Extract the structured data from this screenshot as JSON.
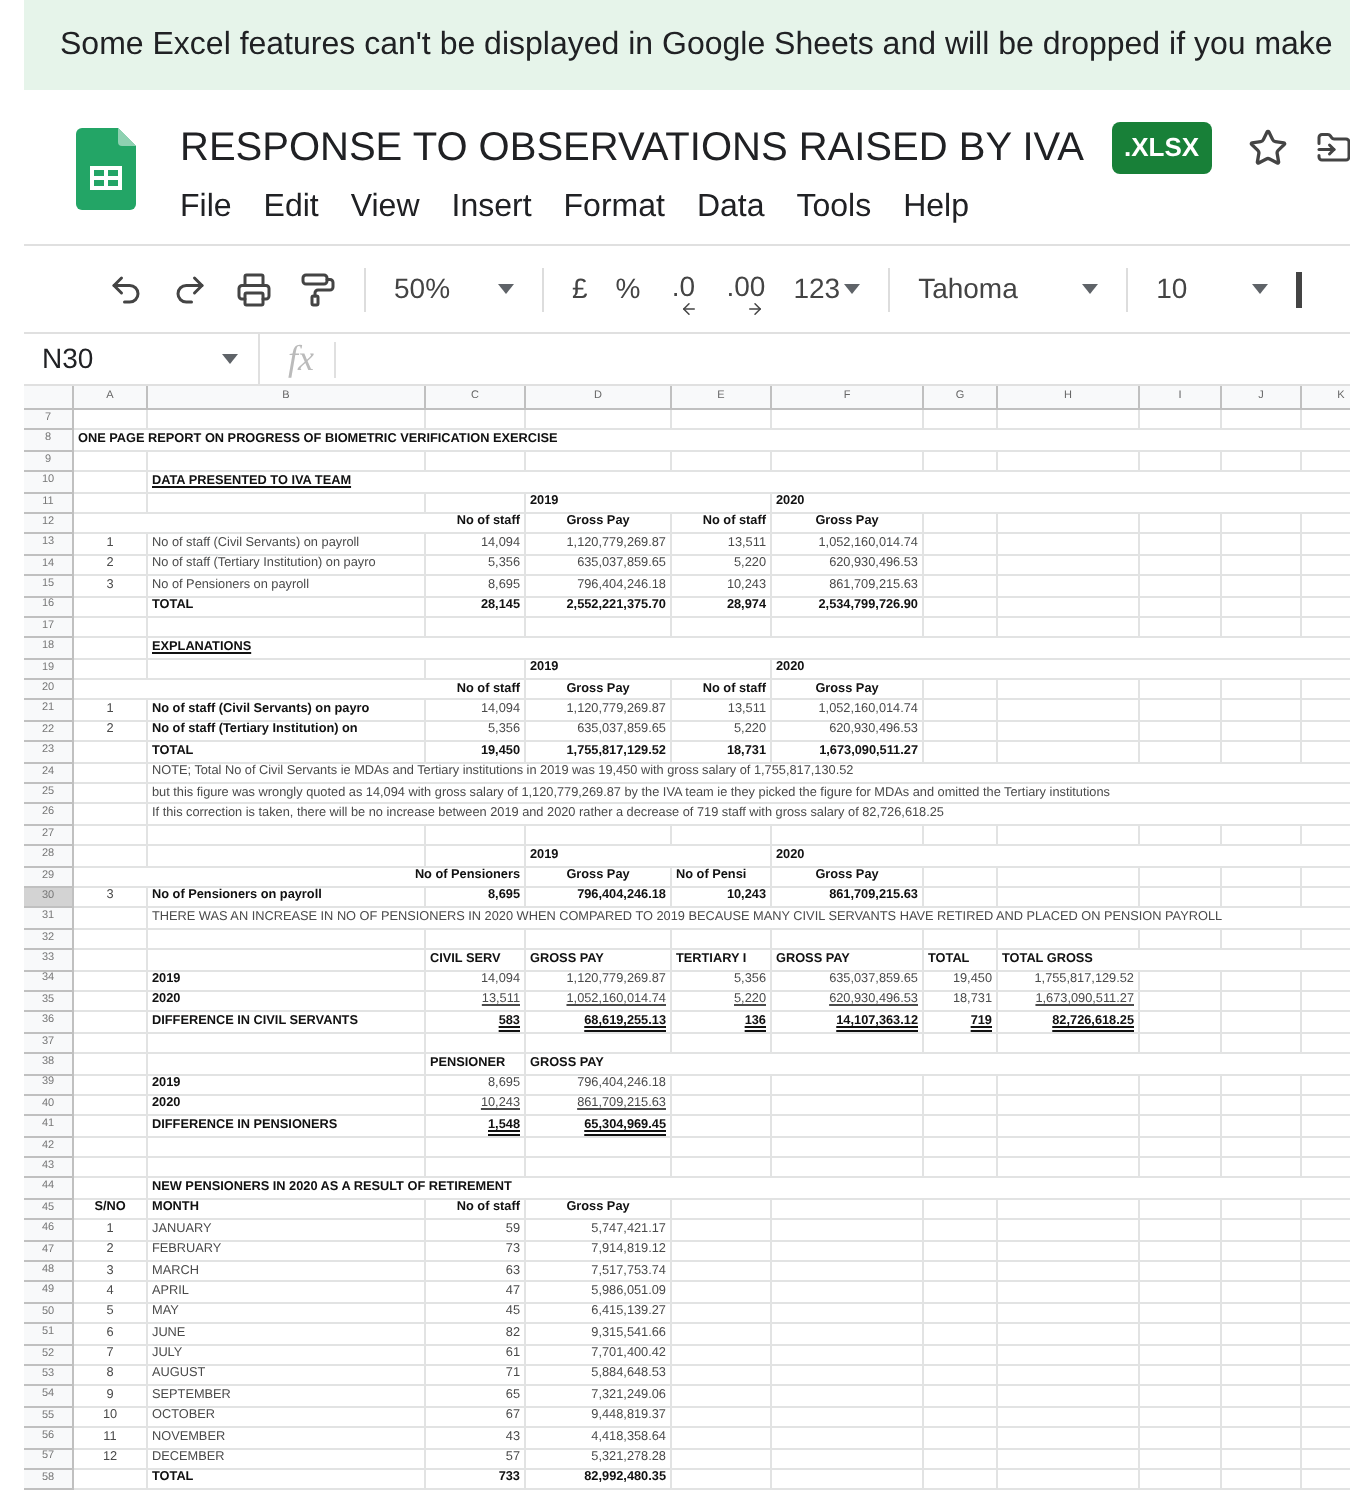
{
  "banner": {
    "text": "Some Excel features can't be displayed in Google Sheets and will be dropped if you make"
  },
  "document": {
    "title": "RESPONSE TO OBSERVATIONS RAISED BY IVA",
    "badge": ".XLSX",
    "starred": false
  },
  "menu": [
    "File",
    "Edit",
    "View",
    "Insert",
    "Format",
    "Data",
    "Tools",
    "Help"
  ],
  "toolbar": {
    "zoom": "50%",
    "currency": "£",
    "percent": "%",
    "decrease_decimals": ".0",
    "increase_decimals": ".00",
    "more_formats": "123",
    "font": "Tahoma",
    "font_size": "10"
  },
  "formula_bar": {
    "cell": "N30",
    "fx": "fx"
  },
  "columns": [
    "A",
    "B",
    "C",
    "D",
    "E",
    "F",
    "G",
    "H",
    "I",
    "J",
    "K"
  ],
  "rows": [
    {
      "number": "7",
      "selected": false
    },
    {
      "number": "8",
      "selected": false,
      "A": {
        "kind": "text",
        "bold": true,
        "text": "ONE PAGE REPORT ON PROGRESS OF BIOMETRIC VERIFICATION EXERCISE"
      }
    },
    {
      "number": "9",
      "selected": false
    },
    {
      "number": "10",
      "selected": false,
      "B": {
        "kind": "text",
        "bold": true,
        "underlined": true,
        "text": "DATA PRESENTED TO IVA TEAM"
      }
    },
    {
      "number": "11",
      "selected": false,
      "D": {
        "kind": "text",
        "bold": true,
        "text": "2019"
      },
      "F": {
        "kind": "text",
        "bold": true,
        "text": "2020"
      }
    },
    {
      "number": "12",
      "selected": false,
      "C": {
        "kind": "number",
        "bold": true,
        "text": "No of staff"
      },
      "D": {
        "kind": "center",
        "bold": true,
        "text": "Gross Pay"
      },
      "E": {
        "kind": "number",
        "bold": true,
        "text": "No of staff"
      },
      "F": {
        "kind": "center",
        "bold": true,
        "text": "Gross Pay"
      }
    },
    {
      "number": "13",
      "selected": false,
      "A": {
        "kind": "center",
        "text": "1"
      },
      "B": {
        "kind": "text",
        "text": "No of staff (Civil Servants) on payroll"
      },
      "C": {
        "kind": "number",
        "text": "14,094"
      },
      "D": {
        "kind": "number",
        "text": "1,120,779,269.87"
      },
      "E": {
        "kind": "number",
        "text": "13,511"
      },
      "F": {
        "kind": "number",
        "text": "1,052,160,014.74"
      }
    },
    {
      "number": "14",
      "selected": false,
      "A": {
        "kind": "center",
        "text": "2"
      },
      "B": {
        "kind": "text",
        "text": "No of staff (Tertiary Institution) on payro"
      },
      "C": {
        "kind": "number",
        "text": "5,356"
      },
      "D": {
        "kind": "number",
        "text": "635,037,859.65"
      },
      "E": {
        "kind": "number",
        "text": "5,220"
      },
      "F": {
        "kind": "number",
        "text": "620,930,496.53"
      }
    },
    {
      "number": "15",
      "selected": false,
      "A": {
        "kind": "center",
        "text": "3"
      },
      "B": {
        "kind": "text",
        "text": "No of Pensioners on payroll"
      },
      "C": {
        "kind": "number",
        "text": "8,695"
      },
      "D": {
        "kind": "number",
        "text": "796,404,246.18"
      },
      "E": {
        "kind": "number",
        "text": "10,243"
      },
      "F": {
        "kind": "number",
        "text": "861,709,215.63"
      }
    },
    {
      "number": "16",
      "selected": false,
      "B": {
        "kind": "text",
        "bold": true,
        "text": "TOTAL"
      },
      "C": {
        "kind": "number",
        "bold": true,
        "text": "28,145"
      },
      "D": {
        "kind": "number",
        "bold": true,
        "text": "2,552,221,375.70"
      },
      "E": {
        "kind": "number",
        "bold": true,
        "text": "28,974"
      },
      "F": {
        "kind": "number",
        "bold": true,
        "text": "2,534,799,726.90"
      }
    },
    {
      "number": "17",
      "selected": false
    },
    {
      "number": "18",
      "selected": false,
      "B": {
        "kind": "text",
        "bold": true,
        "underlined": true,
        "text": "EXPLANATIONS"
      }
    },
    {
      "number": "19",
      "selected": false,
      "D": {
        "kind": "text",
        "bold": true,
        "text": "2019"
      },
      "F": {
        "kind": "text",
        "bold": true,
        "text": "2020"
      }
    },
    {
      "number": "20",
      "selected": false,
      "C": {
        "kind": "number",
        "bold": true,
        "text": "No of staff"
      },
      "D": {
        "kind": "center",
        "bold": true,
        "text": "Gross Pay"
      },
      "E": {
        "kind": "number",
        "bold": true,
        "text": "No of staff"
      },
      "F": {
        "kind": "center",
        "bold": true,
        "text": "Gross Pay"
      }
    },
    {
      "number": "21",
      "selected": false,
      "A": {
        "kind": "center",
        "text": "1"
      },
      "B": {
        "kind": "text",
        "bold": true,
        "text": "No of staff (Civil Servants) on payro"
      },
      "C": {
        "kind": "number",
        "text": "14,094"
      },
      "D": {
        "kind": "number",
        "text": "1,120,779,269.87"
      },
      "E": {
        "kind": "number",
        "text": "13,511"
      },
      "F": {
        "kind": "number",
        "text": "1,052,160,014.74"
      }
    },
    {
      "number": "22",
      "selected": false,
      "A": {
        "kind": "center",
        "text": "2"
      },
      "B": {
        "kind": "text",
        "bold": true,
        "text": "No of staff (Tertiary Institution) on"
      },
      "C": {
        "kind": "number",
        "text": "5,356"
      },
      "D": {
        "kind": "number",
        "text": "635,037,859.65"
      },
      "E": {
        "kind": "number",
        "text": "5,220"
      },
      "F": {
        "kind": "number",
        "text": "620,930,496.53"
      }
    },
    {
      "number": "23",
      "selected": false,
      "B": {
        "kind": "text",
        "bold": true,
        "text": "TOTAL"
      },
      "C": {
        "kind": "number",
        "bold": true,
        "text": "19,450"
      },
      "D": {
        "kind": "number",
        "bold": true,
        "text": "1,755,817,129.52"
      },
      "E": {
        "kind": "number",
        "bold": true,
        "text": "18,731"
      },
      "F": {
        "kind": "number",
        "bold": true,
        "text": "1,673,090,511.27"
      }
    },
    {
      "number": "24",
      "selected": false,
      "B": {
        "kind": "text",
        "text": "NOTE; Total No of Civil Servants ie MDAs and Tertiary institutions in 2019 was 19,450 with gross salary of 1,755,817,130.52"
      }
    },
    {
      "number": "25",
      "selected": false,
      "B": {
        "kind": "text",
        "text": "but this figure was wrongly quoted as 14,094 with gross salary of 1,120,779,269.87 by the IVA team ie they picked the figure for MDAs and omitted the Tertiary institutions"
      }
    },
    {
      "number": "26",
      "selected": false,
      "B": {
        "kind": "text",
        "text": "If this correction is taken, there will be no increase between 2019 and 2020 rather a decrease of 719 staff with gross salary of 82,726,618.25"
      }
    },
    {
      "number": "27",
      "selected": false
    },
    {
      "number": "28",
      "selected": false,
      "D": {
        "kind": "text",
        "bold": true,
        "text": "2019"
      },
      "F": {
        "kind": "text",
        "bold": true,
        "text": "2020"
      }
    },
    {
      "number": "29",
      "selected": false,
      "C": {
        "kind": "number",
        "bold": true,
        "text": "No of Pensioners"
      },
      "D": {
        "kind": "center",
        "bold": true,
        "text": "Gross Pay"
      },
      "E": {
        "kind": "text",
        "bold": true,
        "text": "No of Pensi"
      },
      "F": {
        "kind": "center",
        "bold": true,
        "text": "Gross Pay"
      }
    },
    {
      "number": "30",
      "selected": true,
      "A": {
        "kind": "center",
        "text": "3"
      },
      "B": {
        "kind": "text",
        "bold": true,
        "text": "No of Pensioners on payroll"
      },
      "C": {
        "kind": "number",
        "bold": true,
        "text": "8,695"
      },
      "D": {
        "kind": "number",
        "bold": true,
        "text": "796,404,246.18"
      },
      "E": {
        "kind": "number",
        "bold": true,
        "text": "10,243"
      },
      "F": {
        "kind": "number",
        "bold": true,
        "text": "861,709,215.63"
      }
    },
    {
      "number": "31",
      "selected": false,
      "B": {
        "kind": "text",
        "text": "THERE WAS AN INCREASE IN NO OF PENSIONERS IN 2020 WHEN COMPARED TO 2019 BECAUSE MANY CIVIL SERVANTS HAVE RETIRED AND PLACED ON PENSION PAYROLL"
      }
    },
    {
      "number": "32",
      "selected": false
    },
    {
      "number": "33",
      "selected": false,
      "C": {
        "kind": "text",
        "bold": true,
        "text": "CIVIL SERV"
      },
      "D": {
        "kind": "text",
        "bold": true,
        "text": "GROSS PAY"
      },
      "E": {
        "kind": "text",
        "bold": true,
        "text": "TERTIARY I"
      },
      "F": {
        "kind": "text",
        "bold": true,
        "text": "GROSS PAY"
      },
      "G": {
        "kind": "text",
        "bold": true,
        "text": "TOTAL"
      },
      "H": {
        "kind": "text",
        "bold": true,
        "text": "TOTAL GROSS"
      }
    },
    {
      "number": "34",
      "selected": false,
      "B": {
        "kind": "text",
        "bold": true,
        "text": "2019"
      },
      "C": {
        "kind": "number",
        "text": "14,094"
      },
      "D": {
        "kind": "number",
        "text": "1,120,779,269.87"
      },
      "E": {
        "kind": "number",
        "text": "5,356"
      },
      "F": {
        "kind": "number",
        "text": "635,037,859.65"
      },
      "G": {
        "kind": "number",
        "text": "19,450"
      },
      "H": {
        "kind": "number",
        "text": "1,755,817,129.52"
      }
    },
    {
      "number": "35",
      "selected": false,
      "B": {
        "kind": "text",
        "bold": true,
        "text": "2020"
      },
      "C": {
        "kind": "number",
        "underlined": true,
        "text": "13,511"
      },
      "D": {
        "kind": "number",
        "underlined": true,
        "text": "1,052,160,014.74"
      },
      "E": {
        "kind": "number",
        "underlined": true,
        "text": "5,220"
      },
      "F": {
        "kind": "number",
        "underlined": true,
        "text": "620,930,496.53"
      },
      "G": {
        "kind": "number",
        "text": "18,731"
      },
      "H": {
        "kind": "number",
        "underlined": true,
        "text": "1,673,090,511.27"
      }
    },
    {
      "number": "36",
      "selected": false,
      "B": {
        "kind": "text",
        "bold": true,
        "text": "DIFFERENCE IN CIVIL SERVANTS"
      },
      "C": {
        "kind": "number",
        "bold": true,
        "double_underlined": true,
        "text": "583"
      },
      "D": {
        "kind": "number",
        "bold": true,
        "double_underlined": true,
        "text": "68,619,255.13"
      },
      "E": {
        "kind": "number",
        "bold": true,
        "double_underlined": true,
        "text": "136"
      },
      "F": {
        "kind": "number",
        "bold": true,
        "double_underlined": true,
        "text": "14,107,363.12"
      },
      "G": {
        "kind": "number",
        "bold": true,
        "double_underlined": true,
        "text": "719"
      },
      "H": {
        "kind": "number",
        "bold": true,
        "double_underlined": true,
        "text": "82,726,618.25"
      }
    },
    {
      "number": "37",
      "selected": false
    },
    {
      "number": "38",
      "selected": false,
      "C": {
        "kind": "text",
        "bold": true,
        "text": "PENSIONER"
      },
      "D": {
        "kind": "text",
        "bold": true,
        "text": "GROSS PAY"
      }
    },
    {
      "number": "39",
      "selected": false,
      "B": {
        "kind": "text",
        "bold": true,
        "text": "2019"
      },
      "C": {
        "kind": "number",
        "text": "8,695"
      },
      "D": {
        "kind": "number",
        "text": "796,404,246.18"
      }
    },
    {
      "number": "40",
      "selected": false,
      "B": {
        "kind": "text",
        "bold": true,
        "text": "2020"
      },
      "C": {
        "kind": "number",
        "underlined": true,
        "text": "10,243"
      },
      "D": {
        "kind": "number",
        "underlined": true,
        "text": "861,709,215.63"
      }
    },
    {
      "number": "41",
      "selected": false,
      "B": {
        "kind": "text",
        "bold": true,
        "text": "DIFFERENCE IN PENSIONERS"
      },
      "C": {
        "kind": "number",
        "bold": true,
        "double_underlined": true,
        "text": "1,548"
      },
      "D": {
        "kind": "number",
        "bold": true,
        "double_underlined": true,
        "text": "65,304,969.45"
      }
    },
    {
      "number": "42",
      "selected": false
    },
    {
      "number": "43",
      "selected": false
    },
    {
      "number": "44",
      "selected": false,
      "B": {
        "kind": "text",
        "bold": true,
        "text": "NEW PENSIONERS IN 2020 AS A RESULT OF RETIREMENT"
      }
    },
    {
      "number": "45",
      "selected": false,
      "A": {
        "kind": "center",
        "bold": true,
        "text": "S/NO"
      },
      "B": {
        "kind": "text",
        "bold": true,
        "text": "MONTH"
      },
      "C": {
        "kind": "number",
        "bold": true,
        "text": "No of staff"
      },
      "D": {
        "kind": "center",
        "bold": true,
        "text": "Gross Pay"
      }
    },
    {
      "number": "46",
      "selected": false,
      "A": {
        "kind": "center",
        "text": "1"
      },
      "B": {
        "kind": "text",
        "text": "JANUARY"
      },
      "C": {
        "kind": "number",
        "text": "59"
      },
      "D": {
        "kind": "number",
        "text": "5,747,421.17"
      }
    },
    {
      "number": "47",
      "selected": false,
      "A": {
        "kind": "center",
        "text": "2"
      },
      "B": {
        "kind": "text",
        "text": "FEBRUARY"
      },
      "C": {
        "kind": "number",
        "text": "73"
      },
      "D": {
        "kind": "number",
        "text": "7,914,819.12"
      }
    },
    {
      "number": "48",
      "selected": false,
      "A": {
        "kind": "center",
        "text": "3"
      },
      "B": {
        "kind": "text",
        "text": "MARCH"
      },
      "C": {
        "kind": "number",
        "text": "63"
      },
      "D": {
        "kind": "number",
        "text": "7,517,753.74"
      }
    },
    {
      "number": "49",
      "selected": false,
      "A": {
        "kind": "center",
        "text": "4"
      },
      "B": {
        "kind": "text",
        "text": "APRIL"
      },
      "C": {
        "kind": "number",
        "text": "47"
      },
      "D": {
        "kind": "number",
        "text": "5,986,051.09"
      }
    },
    {
      "number": "50",
      "selected": false,
      "A": {
        "kind": "center",
        "text": "5"
      },
      "B": {
        "kind": "text",
        "text": "MAY"
      },
      "C": {
        "kind": "number",
        "text": "45"
      },
      "D": {
        "kind": "number",
        "text": "6,415,139.27"
      }
    },
    {
      "number": "51",
      "selected": false,
      "A": {
        "kind": "center",
        "text": "6"
      },
      "B": {
        "kind": "text",
        "text": "JUNE"
      },
      "C": {
        "kind": "number",
        "text": "82"
      },
      "D": {
        "kind": "number",
        "text": "9,315,541.66"
      }
    },
    {
      "number": "52",
      "selected": false,
      "A": {
        "kind": "center",
        "text": "7"
      },
      "B": {
        "kind": "text",
        "text": "JULY"
      },
      "C": {
        "kind": "number",
        "text": "61"
      },
      "D": {
        "kind": "number",
        "text": "7,701,400.42"
      }
    },
    {
      "number": "53",
      "selected": false,
      "A": {
        "kind": "center",
        "text": "8"
      },
      "B": {
        "kind": "text",
        "text": "AUGUST"
      },
      "C": {
        "kind": "number",
        "text": "71"
      },
      "D": {
        "kind": "number",
        "text": "5,884,648.53"
      }
    },
    {
      "number": "54",
      "selected": false,
      "A": {
        "kind": "center",
        "text": "9"
      },
      "B": {
        "kind": "text",
        "text": "SEPTEMBER"
      },
      "C": {
        "kind": "number",
        "text": "65"
      },
      "D": {
        "kind": "number",
        "text": "7,321,249.06"
      }
    },
    {
      "number": "55",
      "selected": false,
      "A": {
        "kind": "center",
        "text": "10"
      },
      "B": {
        "kind": "text",
        "text": "OCTOBER"
      },
      "C": {
        "kind": "number",
        "text": "67"
      },
      "D": {
        "kind": "number",
        "text": "9,448,819.37"
      }
    },
    {
      "number": "56",
      "selected": false,
      "A": {
        "kind": "center",
        "text": "11"
      },
      "B": {
        "kind": "text",
        "text": "NOVEMBER"
      },
      "C": {
        "kind": "number",
        "text": "43"
      },
      "D": {
        "kind": "number",
        "text": "4,418,358.64"
      }
    },
    {
      "number": "57",
      "selected": false,
      "A": {
        "kind": "center",
        "text": "12"
      },
      "B": {
        "kind": "text",
        "text": "DECEMBER"
      },
      "C": {
        "kind": "number",
        "text": "57"
      },
      "D": {
        "kind": "number",
        "text": "5,321,278.28"
      }
    },
    {
      "number": "58",
      "selected": false,
      "B": {
        "kind": "text",
        "bold": true,
        "text": "TOTAL"
      },
      "C": {
        "kind": "number",
        "bold": true,
        "text": "733"
      },
      "D": {
        "kind": "number",
        "bold": true,
        "text": "82,992,480.35"
      }
    }
  ]
}
